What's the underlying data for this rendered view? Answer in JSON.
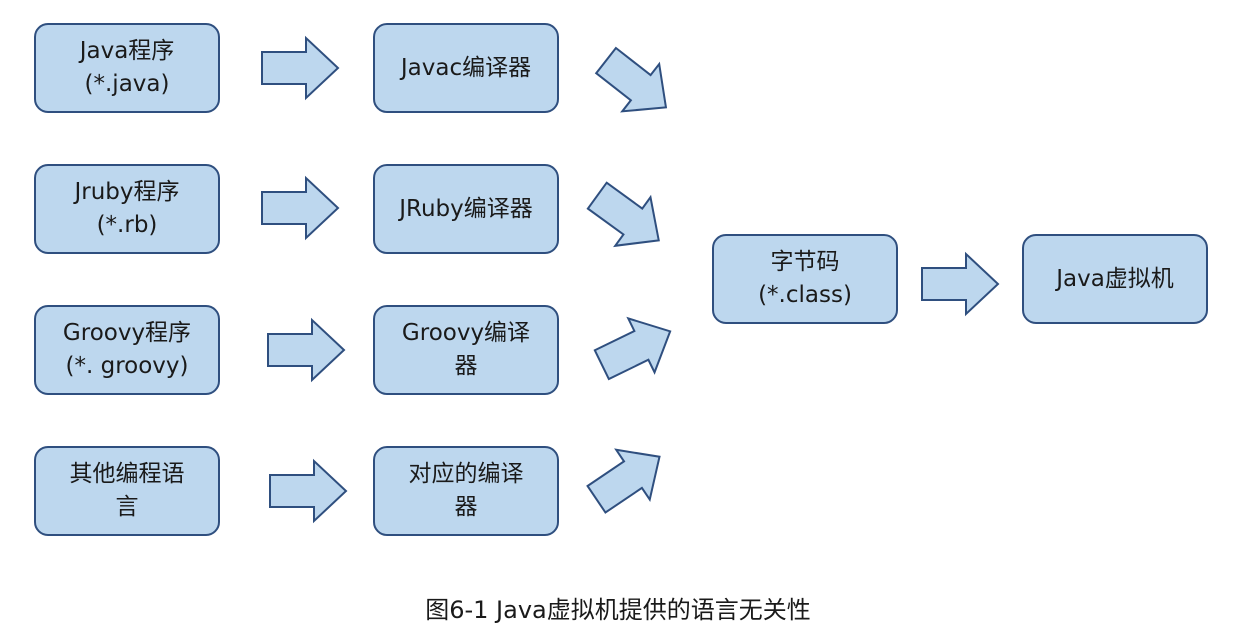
{
  "nodes": {
    "java_program": {
      "line1": "Java程序",
      "line2": "(*.java)"
    },
    "jruby_program": {
      "line1": "Jruby程序",
      "line2": "(*.rb)"
    },
    "groovy_program": {
      "line1": "Groovy程序",
      "line2": "(*. groovy)"
    },
    "other_program": {
      "line1": "其他编程语",
      "line2": "言"
    },
    "javac_compiler": {
      "line1": "Javac编译器"
    },
    "jruby_compiler": {
      "line1": "JRuby编译器"
    },
    "groovy_compiler": {
      "line1": "Groovy编译",
      "line2": "器"
    },
    "other_compiler": {
      "line1": "对应的编译",
      "line2": "器"
    },
    "bytecode": {
      "line1": "字节码",
      "line2": "(*.class)"
    },
    "jvm": {
      "line1": "Java虚拟机"
    }
  },
  "caption": "图6-1 Java虚拟机提供的语言无关性",
  "colors": {
    "box_fill": "#bdd7ee",
    "box_border": "#2f4f7f"
  }
}
